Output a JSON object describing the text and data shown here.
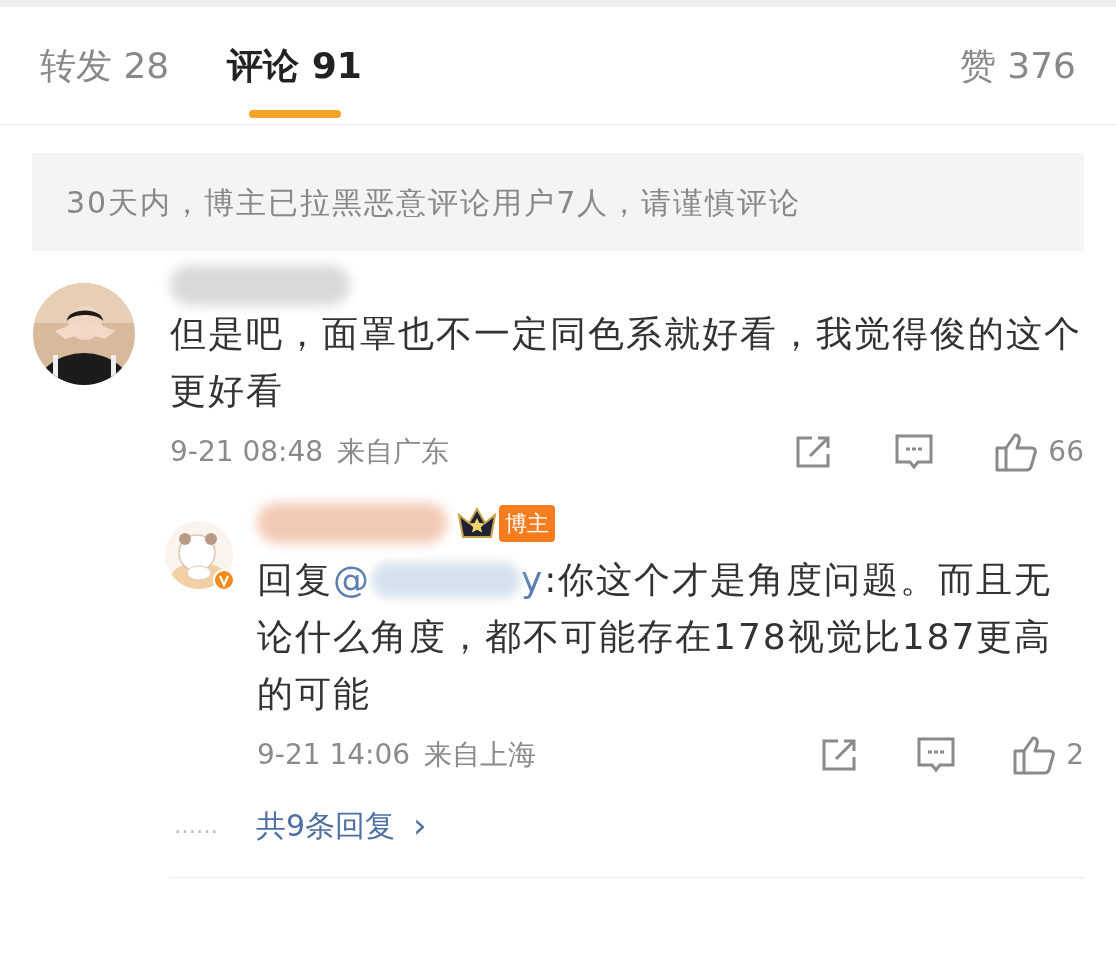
{
  "tabs": [
    {
      "label": "转发 28",
      "selected": false
    },
    {
      "label": "评论 91",
      "selected": true
    },
    {
      "label": "赞 376",
      "selected": false
    }
  ],
  "notice": "30天内，博主已拉黑恶意评论用户7人，请谨慎评论",
  "comment": {
    "text": "但是吧，面罩也不一定同色系就好看，我觉得俊的这个更好看",
    "time": "9-21 08:48",
    "location": "来自广东",
    "likes": "66",
    "reply": {
      "verified": true,
      "badge": "博主",
      "prefix": "回复",
      "mention_start": "@",
      "mention_end": "y",
      "text": ":你这个才是角度问题。而且无论什么角度，都不可能存在178视觉比187更高的可能",
      "time": "9-21 14:06",
      "location": "来自上海",
      "likes": "2"
    },
    "more_dots": "……",
    "more_replies": "共9条回复",
    "more_arrow": "›"
  }
}
